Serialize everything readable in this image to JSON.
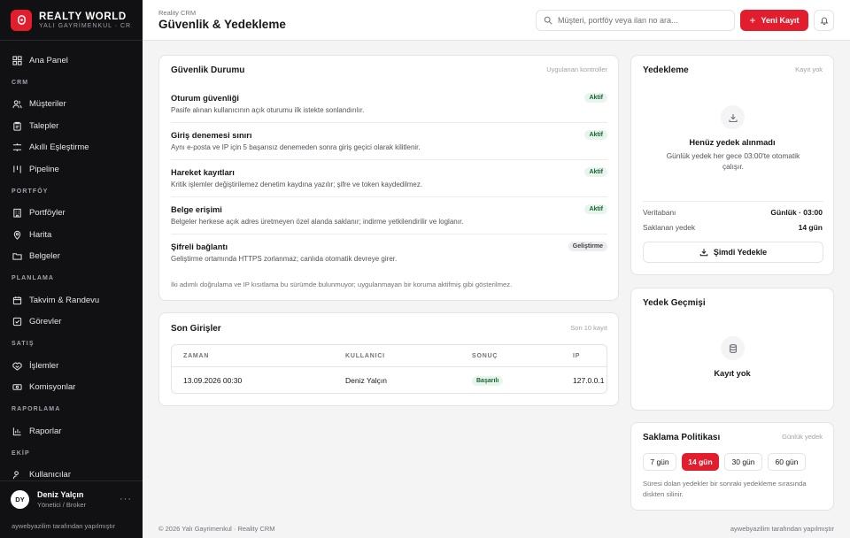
{
  "brand": {
    "title": "REALTY WORLD",
    "subtitle": "YALI GAYRİMENKUL · CR..."
  },
  "nav": {
    "dashboard": "Ana Panel",
    "sections": {
      "crm": "CRM",
      "portfolio": "PORTFÖY",
      "planning": "PLANLAMA",
      "sales": "SATIŞ",
      "reports": "RAPORLAMA",
      "team": "EKİP"
    },
    "customers": "Müşteriler",
    "requests": "Talepler",
    "matching": "Akıllı Eşleştirme",
    "pipeline": "Pipeline",
    "portfolios": "Portföyler",
    "map": "Harita",
    "documents": "Belgeler",
    "calendar": "Takvim & Randevu",
    "tasks": "Görevler",
    "deals": "İşlemler",
    "commissions": "Komisyonlar",
    "reports": "Raporlar",
    "users": "Kullanıcılar"
  },
  "user": {
    "initials": "DY",
    "name": "Deniz Yalçın",
    "role": "Yönetici / Broker",
    "more": "···"
  },
  "sidebar_footer": "aywebyazilim tarafından yapılmıştır",
  "header": {
    "breadcrumb": "Reality CRM",
    "title": "Güvenlik & Yedekleme",
    "search_placeholder": "Müşteri, portföy veya ilan no ara...",
    "new_button": "Yeni Kayıt"
  },
  "security": {
    "title": "Güvenlik Durumu",
    "meta": "Uygulanan kontroller",
    "items": [
      {
        "title": "Oturum güvenliği",
        "desc": "Pasife alınan kullanıcının açık oturumu ilk istekte sonlandırılır.",
        "badge": "Aktif"
      },
      {
        "title": "Giriş denemesi sınırı",
        "desc": "Aynı e-posta ve IP için 5 başarısız denemeden sonra giriş geçici olarak kilitlenir.",
        "badge": "Aktif"
      },
      {
        "title": "Hareket kayıtları",
        "desc": "Kritik işlemler değiştirilemez denetim kaydına yazılır; şifre ve token kaydedilmez.",
        "badge": "Aktif"
      },
      {
        "title": "Belge erişimi",
        "desc": "Belgeler herkese açık adres üretmeyen özel alanda saklanır; indirme yetkilendirilir ve loglanır.",
        "badge": "Aktif"
      },
      {
        "title": "Şifreli bağlantı",
        "desc": "Geliştirme ortamında HTTPS zorlanmaz; canlıda otomatik devreye girer.",
        "badge": "Geliştirme"
      }
    ],
    "note": "İki adımlı doğrulama ve IP kısıtlama bu sürümde bulunmuyor; uygulanmayan bir koruma aktifmiş gibi gösterilmez."
  },
  "logins": {
    "title": "Son Girişler",
    "meta": "Son 10 kayıt",
    "columns": [
      "ZAMAN",
      "KULLANICI",
      "SONUÇ",
      "IP"
    ],
    "rows": [
      {
        "time": "13.09.2026 00:30",
        "user": "Deniz Yalçın",
        "result": "Başarılı",
        "ip": "127.0.0.1"
      }
    ]
  },
  "backup": {
    "title": "Yedekleme",
    "meta": "Kayıt yok",
    "empty_title": "Henüz yedek alınmadı",
    "empty_desc": "Günlük yedek her gece 03:00'te otomatik çalışır.",
    "db_label": "Veritabanı",
    "db_value": "Günlük · 03:00",
    "retained_label": "Saklanan yedek",
    "retained_value": "14 gün",
    "button": "Şimdi Yedekle"
  },
  "history": {
    "title": "Yedek Geçmişi",
    "empty": "Kayıt yok"
  },
  "retention": {
    "title": "Saklama Politikası",
    "meta": "Günlük yedek",
    "options": [
      "7 gün",
      "14 gün",
      "30 gün",
      "60 gün"
    ],
    "selected": "14 gün",
    "note": "Süresi dolan yedekler bir sonraki yedekleme sırasında diskten silinir."
  },
  "footer": {
    "left": "© 2026 Yalı Gayrimenkul · Reality CRM",
    "right": "aywebyazilim tarafından yapılmıştır"
  },
  "colors": {
    "accent": "#e11d2e",
    "sidebar": "#111113",
    "success_bg": "#e8f5ec"
  }
}
